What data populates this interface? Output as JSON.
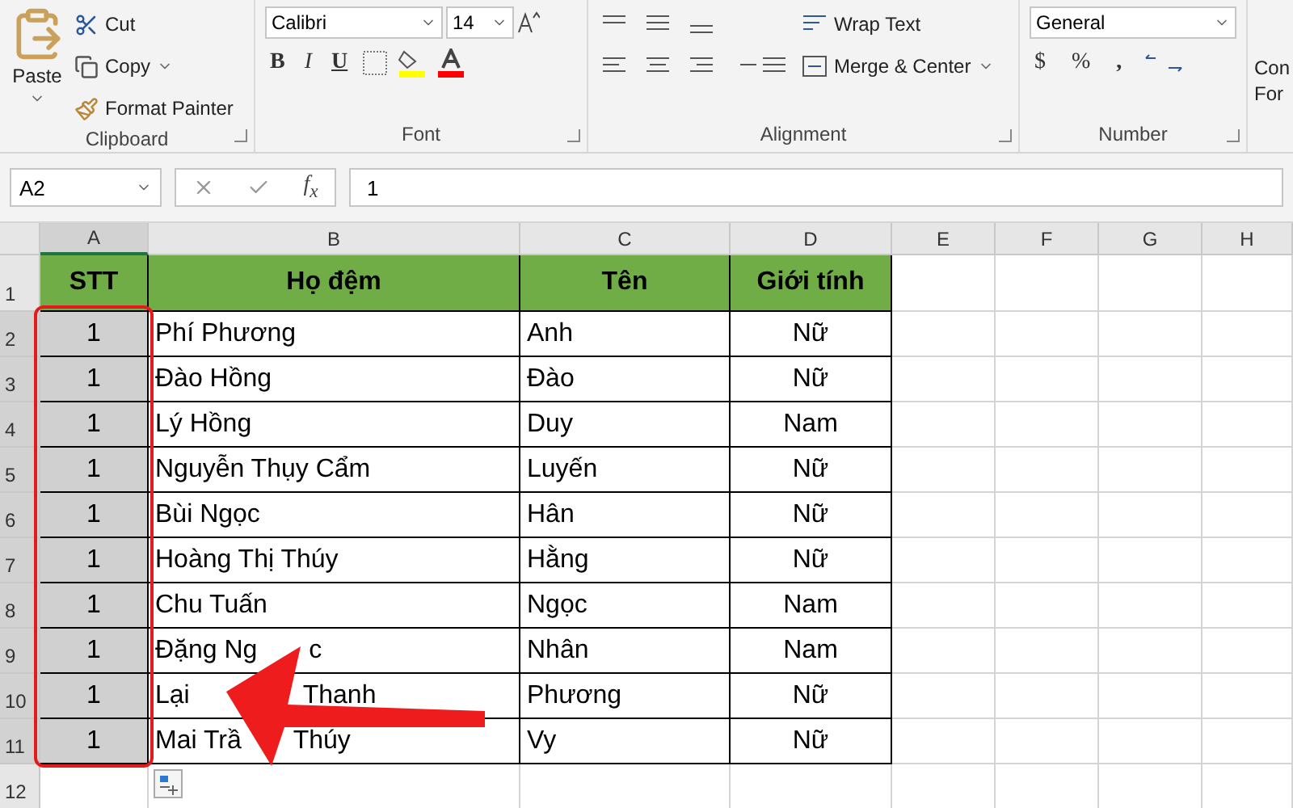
{
  "ribbon": {
    "clipboard": {
      "title": "Clipboard",
      "paste": "Paste",
      "cut": "Cut",
      "copy": "Copy",
      "format_painter": "Format Painter"
    },
    "font": {
      "title": "Font",
      "font_name": "Calibri",
      "font_size": "14",
      "bold": "B",
      "italic": "I",
      "underline": "U"
    },
    "alignment": {
      "title": "Alignment",
      "wrap_text": "Wrap Text",
      "merge_center": "Merge & Center"
    },
    "number": {
      "title": "Number",
      "format": "General",
      "currency": "$",
      "percent": "%",
      "comma": ","
    },
    "styles_cut": [
      "Con",
      "For"
    ]
  },
  "formula_bar": {
    "name_box": "A2",
    "function": "f$_{x}$",
    "value": "1"
  },
  "sheet": {
    "columns": [
      {
        "label": "A",
        "selected": true
      },
      {
        "label": "B",
        "selected": false
      },
      {
        "label": "C",
        "selected": false
      },
      {
        "label": "D",
        "selected": false
      },
      {
        "label": "E",
        "selected": false
      },
      {
        "label": "F",
        "selected": false
      },
      {
        "label": "G",
        "selected": false
      },
      {
        "label": "H",
        "selected": false
      }
    ],
    "rows": [
      {
        "number": "1",
        "selected": false,
        "kind": "header",
        "cells": [
          "STT",
          "Họ đệm",
          "Tên",
          "Giới tính"
        ]
      },
      {
        "number": "2",
        "selected": true,
        "kind": "data",
        "cells": [
          "1",
          "Phí Phương",
          "Anh",
          "Nữ"
        ]
      },
      {
        "number": "3",
        "selected": true,
        "kind": "data",
        "cells": [
          "1",
          "Đào Hồng",
          "Đào",
          "Nữ"
        ]
      },
      {
        "number": "4",
        "selected": true,
        "kind": "data",
        "cells": [
          "1",
          "Lý Hồng",
          "Duy",
          "Nam"
        ]
      },
      {
        "number": "5",
        "selected": true,
        "kind": "data",
        "cells": [
          "1",
          "Nguyễn Thụy Cẩm",
          "Luyến",
          "Nữ"
        ]
      },
      {
        "number": "6",
        "selected": true,
        "kind": "data",
        "cells": [
          "1",
          "Bùi Ngọc",
          "Hân",
          "Nữ"
        ]
      },
      {
        "number": "7",
        "selected": true,
        "kind": "data",
        "cells": [
          "1",
          "Hoàng Thị Thúy",
          "Hằng",
          "Nữ"
        ]
      },
      {
        "number": "8",
        "selected": true,
        "kind": "data",
        "cells": [
          "1",
          "Chu Tuấn",
          "Ngọc",
          "Nam"
        ]
      },
      {
        "number": "9",
        "selected": true,
        "kind": "data",
        "cells": [
          "1",
          [
            "Đặng Ng",
            "c"
          ],
          "Nhân",
          "Nam"
        ]
      },
      {
        "number": "10",
        "selected": true,
        "kind": "data",
        "cells": [
          "1",
          [
            "Lại",
            "Thanh"
          ],
          "Phương",
          "Nữ"
        ]
      },
      {
        "number": "11",
        "selected": true,
        "kind": "data",
        "cells": [
          "1",
          [
            "Mai Trầ",
            "Thúy"
          ],
          "Vy",
          "Nữ"
        ]
      },
      {
        "number": "12",
        "selected": false,
        "kind": "empty",
        "cells": []
      }
    ]
  }
}
